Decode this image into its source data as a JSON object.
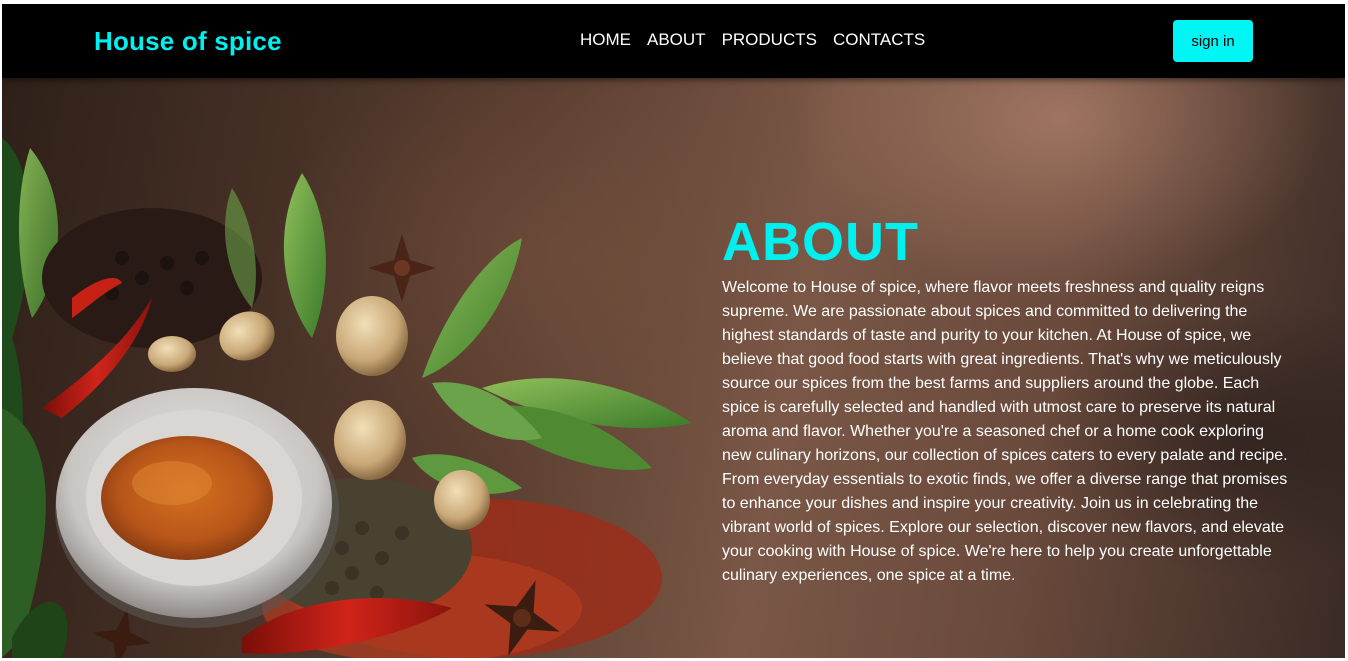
{
  "header": {
    "brand": "House of spice",
    "nav": [
      {
        "label": "HOME"
      },
      {
        "label": "ABOUT"
      },
      {
        "label": "PRODUCTS"
      },
      {
        "label": "CONTACTS"
      }
    ],
    "signin_label": "sign in"
  },
  "about": {
    "title": "ABOUT",
    "body": "Welcome to House of spice, where flavor meets freshness and quality reigns supreme. We are passionate about spices and committed to delivering the highest standards of taste and purity to your kitchen. At House of spice, we believe that good food starts with great ingredients. That's why we meticulously source our spices from the best farms and suppliers around the globe. Each spice is carefully selected and handled with utmost care to preserve its natural aroma and flavor. Whether you're a seasoned chef or a home cook exploring new culinary horizons, our collection of spices caters to every palate and recipe. From everyday essentials to exotic finds, we offer a diverse range that promises to enhance your dishes and inspire your creativity. Join us in celebrating the vibrant world of spices. Explore our selection, discover new flavors, and elevate your cooking with House of spice. We're here to help you create unforgettable culinary experiences, one spice at a time."
  },
  "colors": {
    "accent": "#00f0f0",
    "navbar_bg": "#000000",
    "signin_bg": "#00f5f5"
  },
  "hero_image": {
    "icon": "spices-photo"
  }
}
